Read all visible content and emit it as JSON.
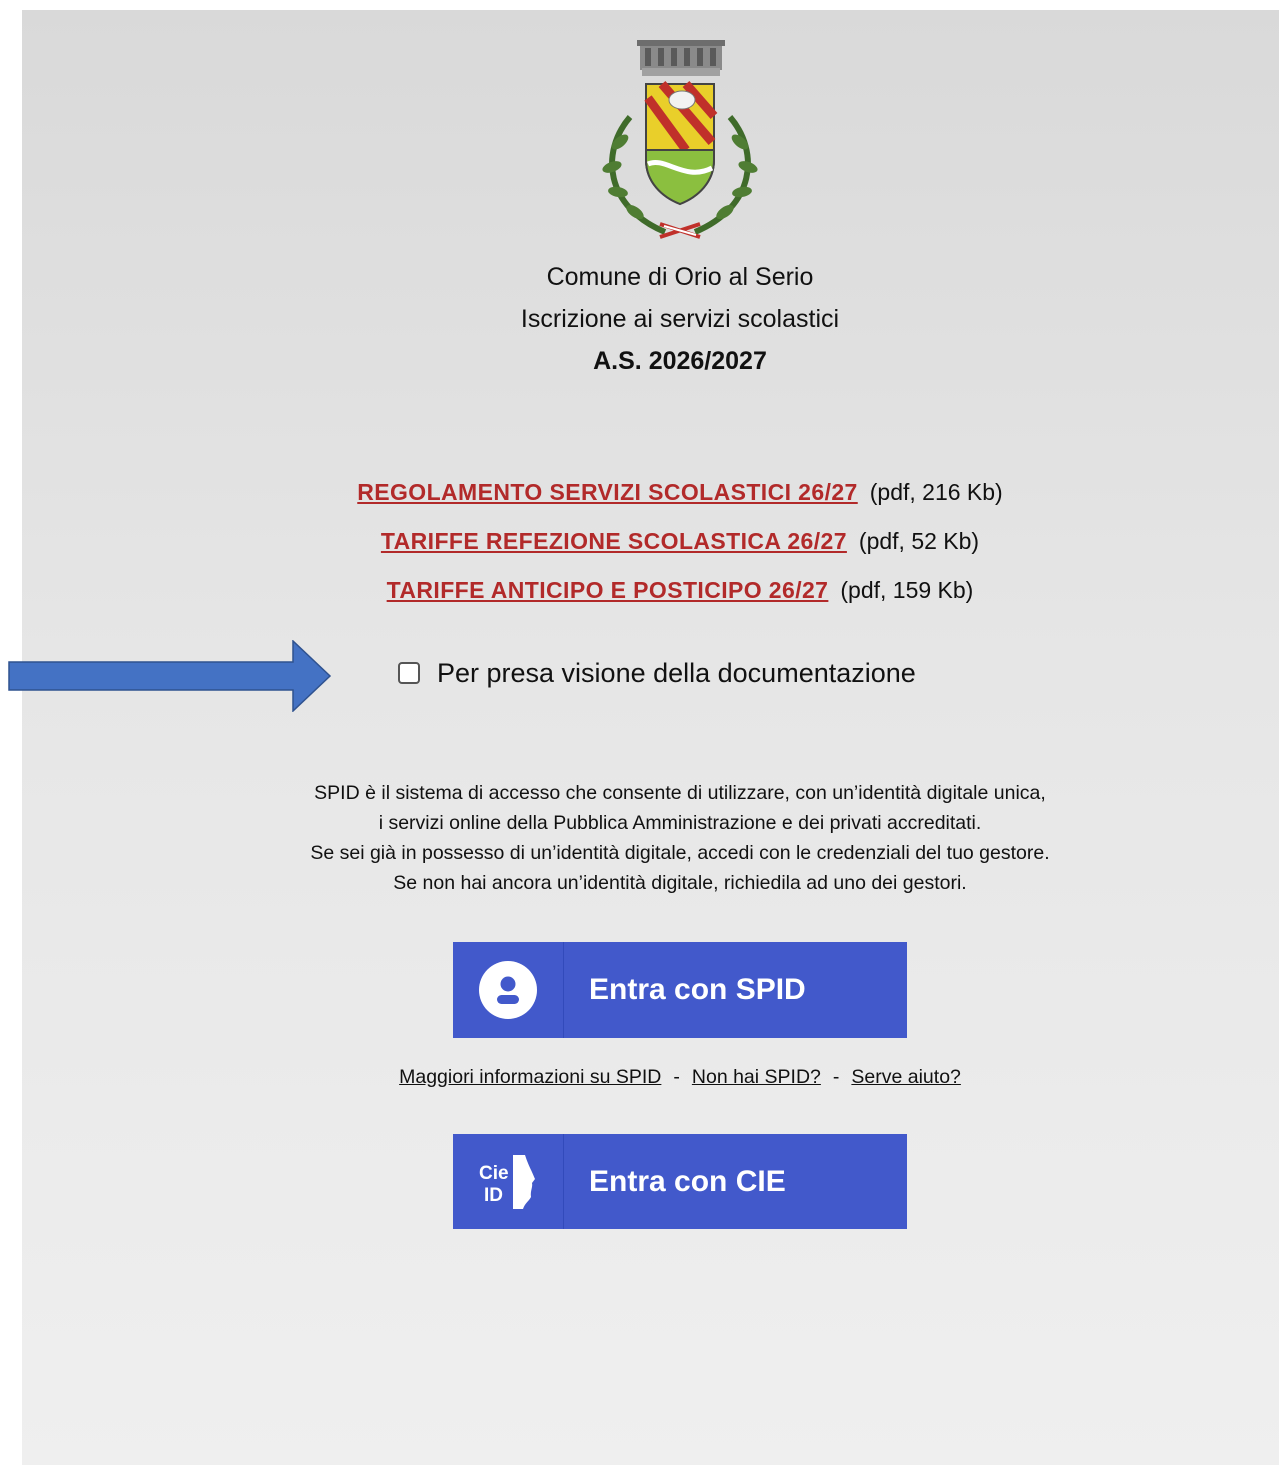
{
  "header": {
    "municipality": "Comune di Orio al Serio",
    "service": "Iscrizione ai servizi scolastici",
    "school_year": "A.S. 2026/2027"
  },
  "documents": [
    {
      "label": "REGOLAMENTO SERVIZI SCOLASTICI 26/27",
      "meta": "(pdf, 216 Kb)"
    },
    {
      "label": "TARIFFE REFEZIONE SCOLASTICA 26/27",
      "meta": "(pdf, 52 Kb)"
    },
    {
      "label": "TARIFFE ANTICIPO E POSTICIPO 26/27",
      "meta": "(pdf, 159 Kb)"
    }
  ],
  "consent": {
    "label": "Per presa visione della documentazione",
    "checked": false
  },
  "spid_description": [
    "SPID è il sistema di accesso che consente di utilizzare, con un’identità digitale unica,",
    "i servizi online della Pubblica Amministrazione e dei privati accreditati.",
    "Se sei già in possesso di un’identità digitale, accedi con le credenziali del tuo gestore.",
    "Se non hai ancora un’identità digitale, richiedila ad uno dei gestori."
  ],
  "spid_button": {
    "label": "Entra con SPID",
    "icon": "user-icon"
  },
  "spid_links": {
    "info": "Maggiori informazioni su SPID",
    "no_spid": "Non hai SPID?",
    "help": "Serve aiuto?",
    "separator": "-"
  },
  "cie_button": {
    "label": "Entra con CIE",
    "icon": "cie-id-logo"
  },
  "colors": {
    "button_blue": "#4259cb",
    "link_red": "#b22a2a",
    "arrow_blue": "#4472c4"
  }
}
